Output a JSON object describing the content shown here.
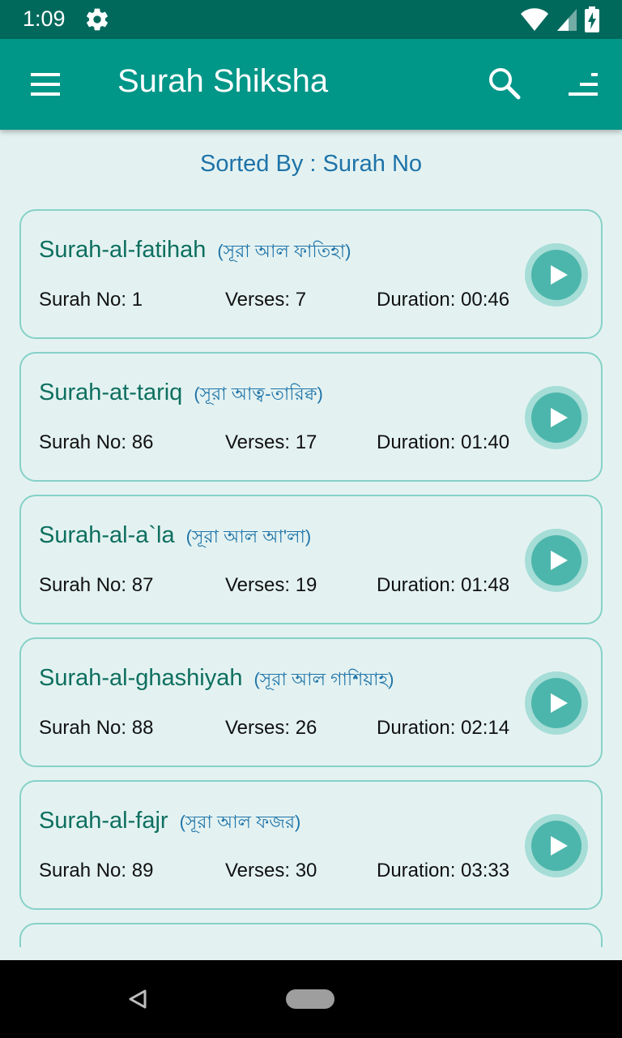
{
  "status": {
    "time": "1:09"
  },
  "app_bar": {
    "title": "Surah Shiksha"
  },
  "sorted": {
    "label": "Sorted By : Surah No"
  },
  "surahs": [
    {
      "name": "Surah-al-fatihah",
      "bangla": "(সূরা আল ফাতিহা)",
      "surah_no": "Surah No: 1",
      "verses": "Verses: 7",
      "duration": "Duration: 00:46"
    },
    {
      "name": "Surah-at-tariq",
      "bangla": "(সূরা আত্ব-তারিক্ব)",
      "surah_no": "Surah No: 86",
      "verses": "Verses: 17",
      "duration": "Duration: 01:40"
    },
    {
      "name": "Surah-al-a`la",
      "bangla": "(সূরা আল আ'লা)",
      "surah_no": "Surah No: 87",
      "verses": "Verses: 19",
      "duration": "Duration: 01:48"
    },
    {
      "name": "Surah-al-ghashiyah",
      "bangla": "(সূরা আল গাশিয়াহ)",
      "surah_no": "Surah No: 88",
      "verses": "Verses: 26",
      "duration": "Duration: 02:14"
    },
    {
      "name": "Surah-al-fajr",
      "bangla": "(সূরা আল ফজর)",
      "surah_no": "Surah No: 89",
      "verses": "Verses: 30",
      "duration": "Duration: 03:33"
    }
  ],
  "icons": {
    "status": [
      "gear-icon",
      "wifi-icon",
      "cellular-signal-icon",
      "battery-charging-icon"
    ],
    "app_bar": [
      "hamburger-menu-icon",
      "search-icon",
      "sort-icon"
    ],
    "card": "play-icon",
    "nav": [
      "back-triangle-icon",
      "home-pill-icon"
    ]
  },
  "colors": {
    "status_bar": "#00695c",
    "app_bar": "#009688",
    "background": "#e3f2f1",
    "card_border": "#86d1c7",
    "title_text": "#0e6f5f",
    "bangla_text": "#1e73a8",
    "play_button": "#4db6ac"
  }
}
